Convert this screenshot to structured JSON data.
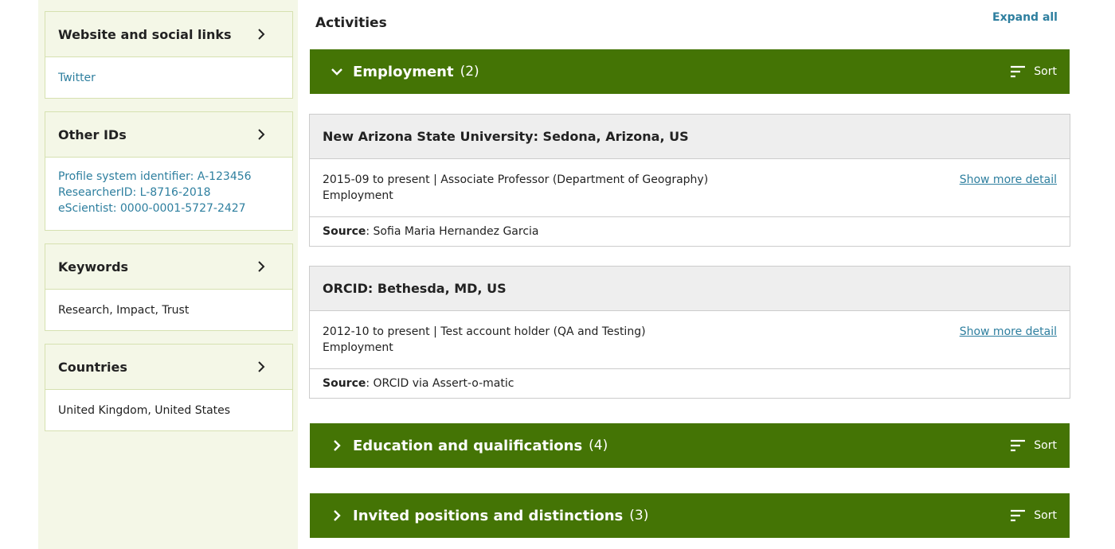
{
  "sidebar": {
    "cards": [
      {
        "title": "Website and social links",
        "items": [
          "Twitter"
        ]
      },
      {
        "title": "Other IDs",
        "items": [
          "Profile system identifier: A-123456",
          "ResearcherID: L-8716-2018",
          "eScientist: 0000-0001-5727-2427"
        ]
      },
      {
        "title": "Keywords",
        "items": [
          "Research, Impact, Trust"
        ]
      },
      {
        "title": "Countries",
        "items": [
          "United Kingdom, United States"
        ]
      }
    ]
  },
  "main": {
    "title": "Activities",
    "expand_all": "Expand all",
    "sort_label": "Sort",
    "sections": [
      {
        "title": "Employment",
        "count": "(2)",
        "expanded": true
      },
      {
        "title": "Education and qualifications",
        "count": "(4)",
        "expanded": false
      },
      {
        "title": "Invited positions and distinctions",
        "count": "(3)",
        "expanded": false
      }
    ],
    "entries": [
      {
        "org": "New Arizona State University: Sedona, Arizona, US",
        "dates_role": "2015-09 to present | Associate Professor (Department of Geography)",
        "type": "Employment",
        "more": "Show more detail",
        "source_label": "Source",
        "source": ": Sofia Maria Hernandez Garcia"
      },
      {
        "org": "ORCID: Bethesda, MD, US",
        "dates_role": "2012-10 to present | Test account holder (QA and Testing)",
        "type": "Employment",
        "more": "Show more detail",
        "source_label": "Source",
        "source": ": ORCID via Assert-o-matic"
      }
    ]
  },
  "colors": {
    "accent_green": "#447405",
    "sidebar_bg": "#f4f7e7",
    "link": "#2e7f9f"
  },
  "icons": {
    "card_toggle": "chevron-right-icon",
    "section_expanded": "chevron-down-icon",
    "section_collapsed": "chevron-right-icon",
    "sort": "sort-icon"
  }
}
